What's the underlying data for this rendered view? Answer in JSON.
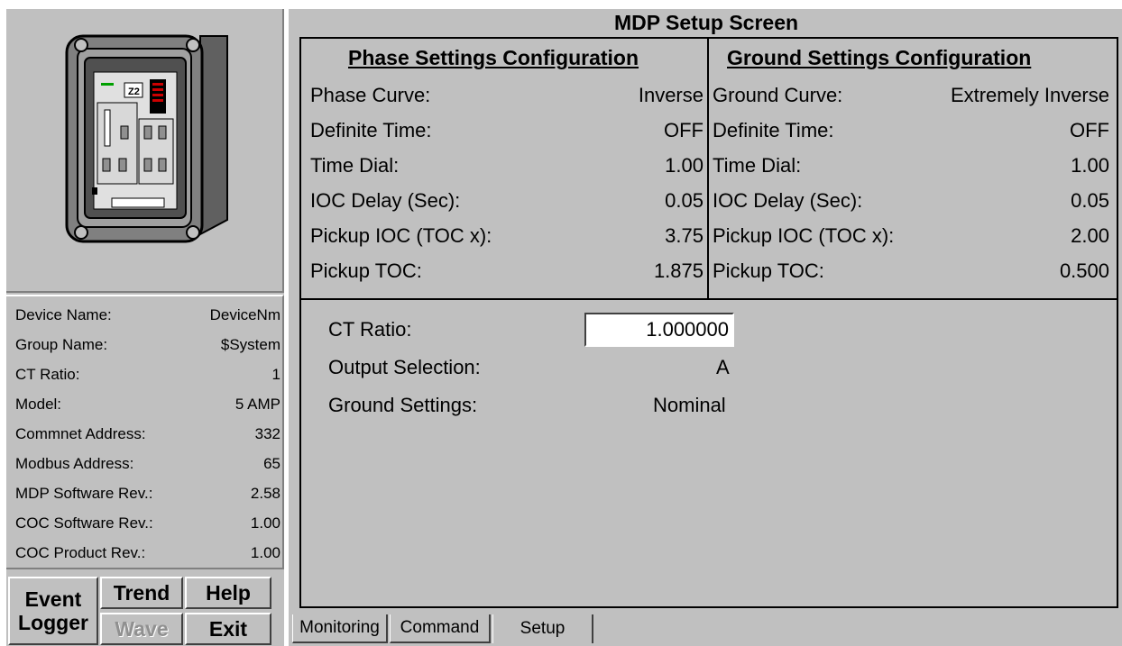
{
  "main_title": "MDP Setup Screen",
  "phase": {
    "title": "Phase Settings Configuration",
    "rows": [
      {
        "label": "Phase Curve:",
        "value": "Inverse"
      },
      {
        "label": "Definite Time:",
        "value": "OFF"
      },
      {
        "label": "Time Dial:",
        "value": "1.00"
      },
      {
        "label": "IOC Delay (Sec):",
        "value": "0.05"
      },
      {
        "label": "Pickup IOC (TOC x):",
        "value": "3.75"
      },
      {
        "label": "Pickup TOC:",
        "value": "1.875"
      }
    ]
  },
  "ground": {
    "title": "Ground Settings Configuration",
    "rows": [
      {
        "label": "Ground Curve:",
        "value": "Extremely Inverse"
      },
      {
        "label": "Definite Time:",
        "value": "OFF"
      },
      {
        "label": "Time Dial:",
        "value": "1.00"
      },
      {
        "label": "IOC Delay (Sec):",
        "value": "0.05"
      },
      {
        "label": "Pickup IOC (TOC x):",
        "value": "2.00"
      },
      {
        "label": "Pickup TOC:",
        "value": "0.500"
      }
    ]
  },
  "lower": {
    "ct_ratio_label": "CT Ratio:",
    "ct_ratio_value": "1.000000",
    "output_label": "Output Selection:",
    "output_value": "A",
    "ground_label": "Ground Settings:",
    "ground_value": "Nominal"
  },
  "device_info": [
    {
      "label": "Device Name:",
      "value": "DeviceNm"
    },
    {
      "label": "Group Name:",
      "value": "$System"
    },
    {
      "label": "CT Ratio:",
      "value": "1"
    },
    {
      "label": "Model:",
      "value": "5 AMP"
    },
    {
      "label": "Commnet Address:",
      "value": "332"
    },
    {
      "label": "Modbus Address:",
      "value": "65"
    },
    {
      "label": "MDP Software Rev.:",
      "value": "2.58"
    },
    {
      "label": "COC Software Rev.:",
      "value": "1.00"
    },
    {
      "label": "COC Product Rev.:",
      "value": "1.00"
    }
  ],
  "device_display_text": "Z2",
  "buttons": {
    "event_line1": "Event",
    "event_line2": "Logger",
    "trend": "Trend",
    "help": "Help",
    "wave": "Wave",
    "exit": "Exit"
  },
  "tabs": [
    "Monitoring",
    "Command",
    "Setup"
  ]
}
